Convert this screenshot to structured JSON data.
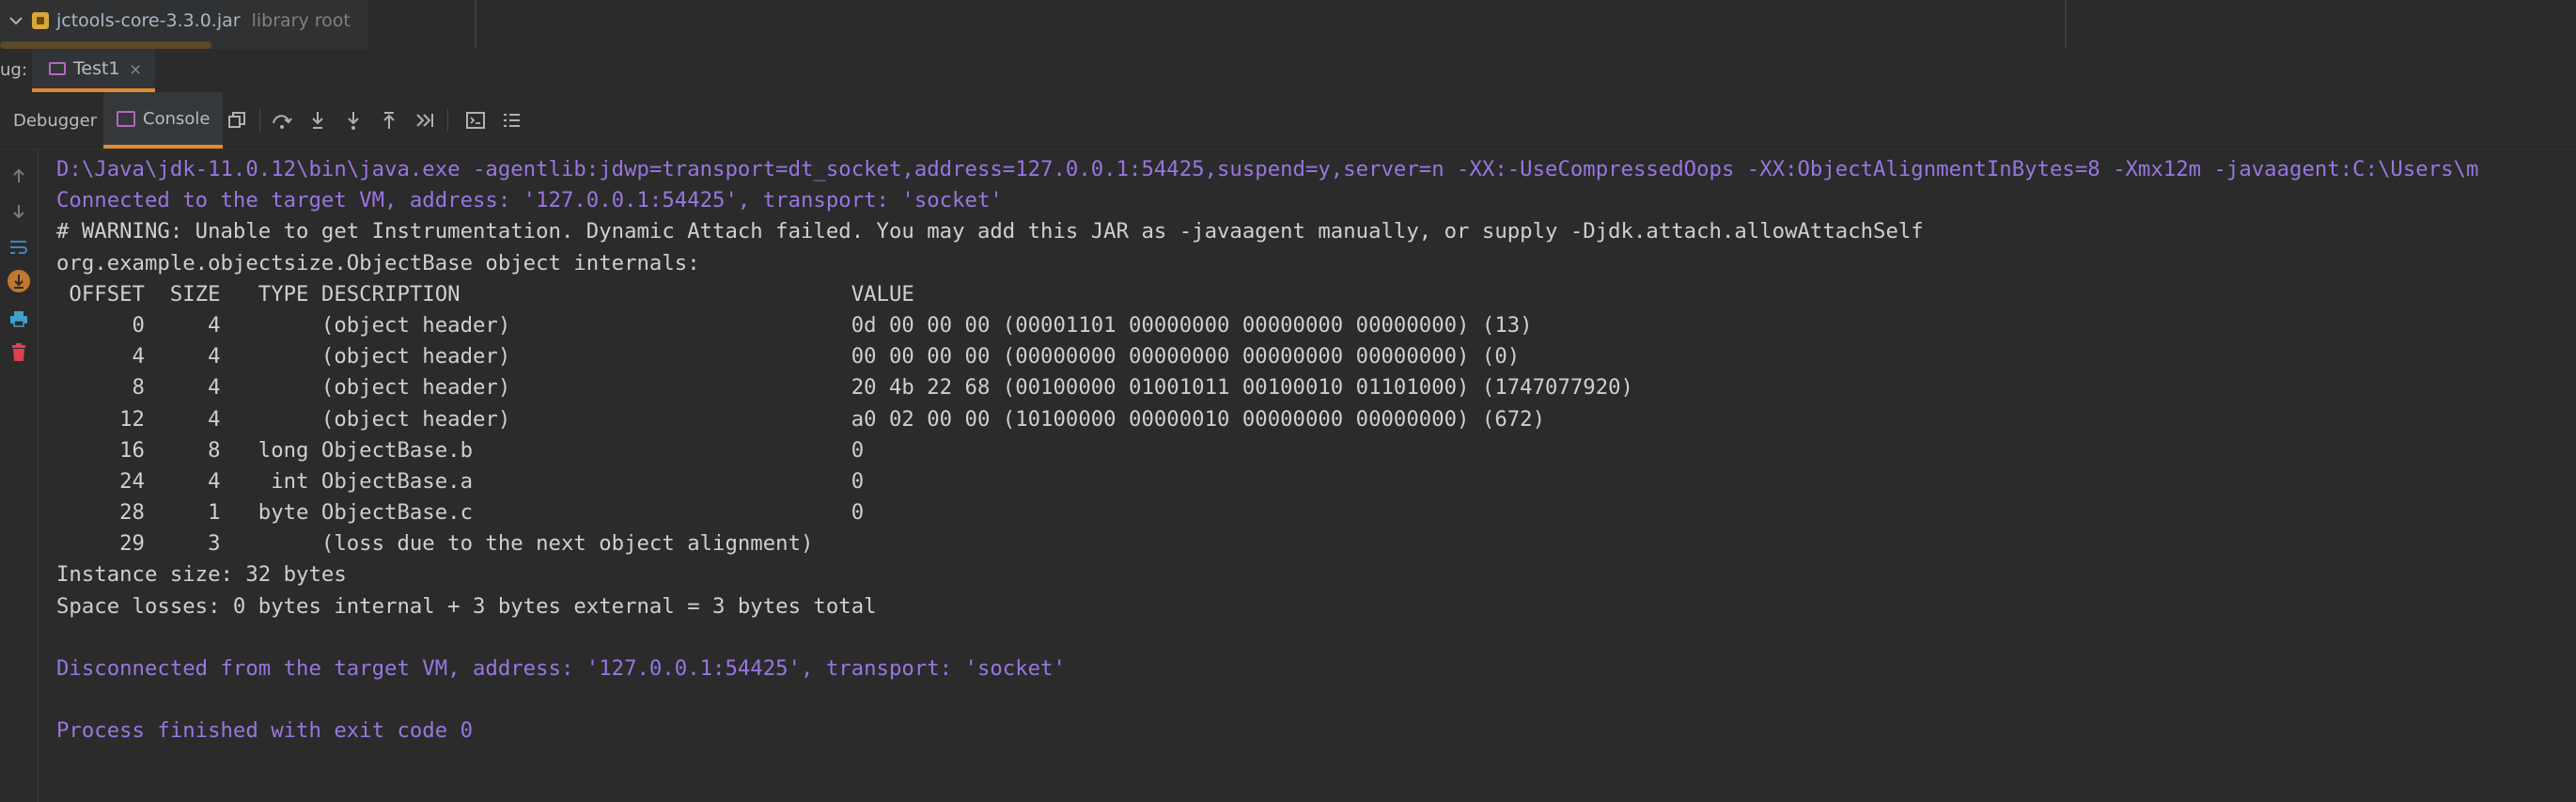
{
  "project_tree": {
    "item_name": "jctools-core-3.3.0.jar",
    "item_hint": "library root"
  },
  "debug_bar": {
    "label": "ug:",
    "session_tab": "Test1",
    "close_symbol": "×"
  },
  "toolbar": {
    "debugger_tab": "Debugger",
    "console_tab": "Console",
    "buttons": [
      "restore-layout-icon",
      "step-over-icon",
      "step-into-icon",
      "force-step-into-icon",
      "step-out-icon",
      "run-to-cursor-icon",
      "evaluate-icon",
      "trace-icon"
    ]
  },
  "gutter": {
    "buttons": [
      "up-arrow-icon",
      "down-arrow-icon",
      "soft-wrap-icon",
      "scroll-to-end-icon",
      "print-icon",
      "clear-all-icon"
    ]
  },
  "console": {
    "lines": [
      {
        "kind": "cmd",
        "text": "D:\\Java\\jdk-11.0.12\\bin\\java.exe -agentlib:jdwp=transport=dt_socket,address=127.0.0.1:54425,suspend=y,server=n -XX:-UseCompressedOops -XX:ObjectAlignmentInBytes=8 -Xmx12m -javaagent:C:\\Users\\m"
      },
      {
        "kind": "sys",
        "text": "Connected to the target VM, address: '127.0.0.1:54425', transport: 'socket'"
      },
      {
        "kind": "out",
        "text": "# WARNING: Unable to get Instrumentation. Dynamic Attach failed. You may add this JAR as -javaagent manually, or supply -Djdk.attach.allowAttachSelf"
      },
      {
        "kind": "out",
        "text": "org.example.objectsize.ObjectBase object internals:"
      },
      {
        "kind": "out",
        "text": " OFFSET  SIZE   TYPE DESCRIPTION                               VALUE"
      },
      {
        "kind": "out",
        "text": "      0     4        (object header)                           0d 00 00 00 (00001101 00000000 00000000 00000000) (13)"
      },
      {
        "kind": "out",
        "text": "      4     4        (object header)                           00 00 00 00 (00000000 00000000 00000000 00000000) (0)"
      },
      {
        "kind": "out",
        "text": "      8     4        (object header)                           20 4b 22 68 (00100000 01001011 00100010 01101000) (1747077920)"
      },
      {
        "kind": "out",
        "text": "     12     4        (object header)                           a0 02 00 00 (10100000 00000010 00000000 00000000) (672)"
      },
      {
        "kind": "out",
        "text": "     16     8   long ObjectBase.b                              0"
      },
      {
        "kind": "out",
        "text": "     24     4    int ObjectBase.a                              0"
      },
      {
        "kind": "out",
        "text": "     28     1   byte ObjectBase.c                              0"
      },
      {
        "kind": "out",
        "text": "     29     3        (loss due to the next object alignment)"
      },
      {
        "kind": "out",
        "text": "Instance size: 32 bytes"
      },
      {
        "kind": "out",
        "text": "Space losses: 0 bytes internal + 3 bytes external = 3 bytes total"
      },
      {
        "kind": "out",
        "text": ""
      },
      {
        "kind": "sys",
        "text": "Disconnected from the target VM, address: '127.0.0.1:54425', transport: 'socket'"
      },
      {
        "kind": "out",
        "text": ""
      },
      {
        "kind": "sys",
        "text": "Process finished with exit code 0"
      }
    ]
  },
  "colors": {
    "background": "#2b2b2b",
    "accent_underline": "#e3892f",
    "system_text": "#9876e0",
    "output_text": "#cfcfcf"
  }
}
